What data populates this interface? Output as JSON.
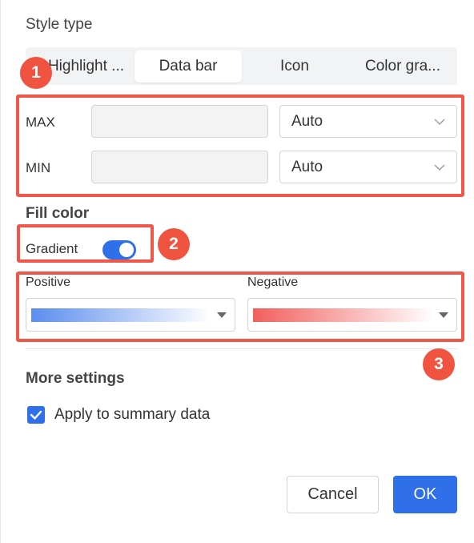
{
  "style_type": {
    "title": "Style type",
    "tabs": [
      {
        "label": "Highlight ..."
      },
      {
        "label": "Data bar"
      },
      {
        "label": "Icon"
      },
      {
        "label": "Color gra..."
      }
    ],
    "selected_tab": "Data bar"
  },
  "range": {
    "max": {
      "label": "MAX",
      "value": "",
      "mode": "Auto"
    },
    "min": {
      "label": "MIN",
      "value": "",
      "mode": "Auto"
    }
  },
  "fill_color": {
    "title": "Fill color",
    "gradient_label": "Gradient",
    "gradient_enabled": true,
    "positive_label": "Positive",
    "negative_label": "Negative",
    "positive_color": "#5b8def",
    "negative_color": "#f25f5c"
  },
  "more_settings": {
    "title": "More settings",
    "apply_summary_label": "Apply to summary data",
    "apply_summary_checked": true
  },
  "buttons": {
    "cancel": "Cancel",
    "ok": "OK"
  },
  "badges": {
    "one": "1",
    "two": "2",
    "three": "3"
  },
  "colors": {
    "accent": "#2f6fea",
    "annotation": "#f0574a"
  }
}
